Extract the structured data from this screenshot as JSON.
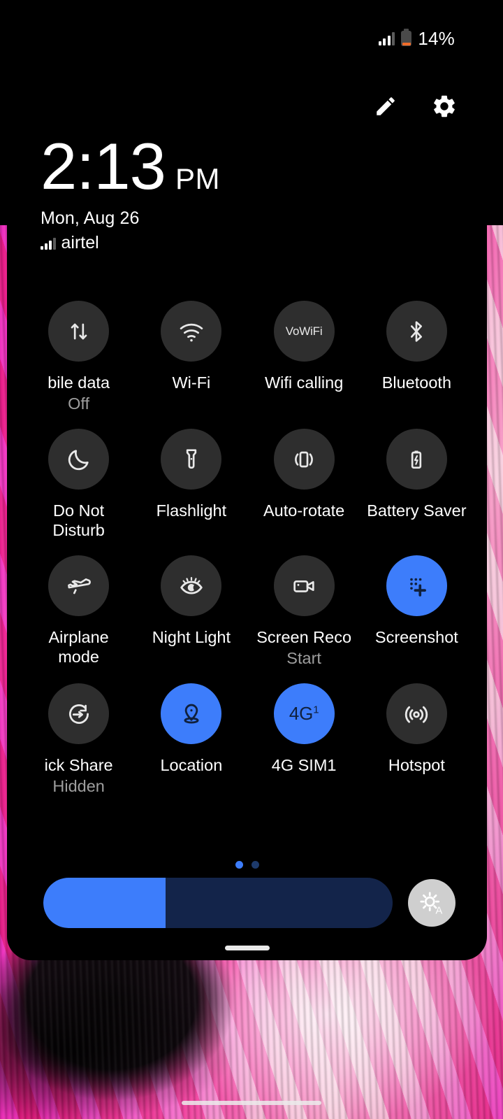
{
  "status_bar": {
    "battery_percent": "14%",
    "signal_icon": "signal-bars-icon",
    "battery_icon": "battery-low-icon",
    "battery_color": "#ef6c2a"
  },
  "panel_header": {
    "edit_icon": "pencil-edit-icon",
    "settings_icon": "gear-icon"
  },
  "clock": {
    "time": "2:13",
    "ampm": "PM",
    "date": "Mon, Aug 26",
    "carrier": "airtel",
    "carrier_signal_icon": "signal-bars-icon"
  },
  "tiles": [
    {
      "label": "bile data",
      "sub": "Off",
      "icon": "mobile-data-arrows-icon",
      "active": false,
      "clipped": true
    },
    {
      "label": "Wi-Fi",
      "sub": "",
      "icon": "wifi-icon",
      "active": false,
      "clipped": false
    },
    {
      "label": "Wifi calling",
      "sub": "",
      "icon": "vowifi-text-icon",
      "icon_text": "VoWiFi",
      "active": false,
      "clipped": false
    },
    {
      "label": "Bluetooth",
      "sub": "",
      "icon": "bluetooth-icon",
      "active": false,
      "clipped": false
    },
    {
      "label": "Do Not Disturb",
      "sub": "",
      "icon": "moon-icon",
      "active": false,
      "clipped": false
    },
    {
      "label": "Flashlight",
      "sub": "",
      "icon": "flashlight-icon",
      "active": false,
      "clipped": false
    },
    {
      "label": "Auto-rotate",
      "sub": "",
      "icon": "auto-rotate-icon",
      "active": false,
      "clipped": false
    },
    {
      "label": "Battery Saver",
      "sub": "",
      "icon": "battery-bolt-icon",
      "active": false,
      "clipped": false
    },
    {
      "label": "Airplane mode",
      "sub": "",
      "icon": "airplane-icon",
      "active": false,
      "clipped": false
    },
    {
      "label": "Night Light",
      "sub": "",
      "icon": "night-light-eye-icon",
      "active": false,
      "clipped": false
    },
    {
      "label": "Screen Reco",
      "sub": "Start",
      "icon": "video-camera-icon",
      "active": false,
      "clipped": true
    },
    {
      "label": "Screenshot",
      "sub": "",
      "icon": "screenshot-crosshair-icon",
      "active": true,
      "clipped": false
    },
    {
      "label": "ick Share",
      "sub": "Hidden",
      "icon": "quick-share-icon",
      "active": false,
      "clipped": true
    },
    {
      "label": "Location",
      "sub": "",
      "icon": "location-pin-icon",
      "active": true,
      "clipped": false
    },
    {
      "label": "4G SIM1",
      "sub": "",
      "icon": "four-g-text-icon",
      "icon_text": "4G",
      "icon_sup": "1",
      "active": true,
      "clipped": false
    },
    {
      "label": "Hotspot",
      "sub": "",
      "icon": "hotspot-icon",
      "active": false,
      "clipped": false
    }
  ],
  "pages": {
    "count": 2,
    "current": 1
  },
  "brightness": {
    "value_percent": 35,
    "auto_icon": "auto-brightness-sun-a-icon",
    "fill_color": "#3d7dfb",
    "track_color": "#13244a"
  },
  "panel": {
    "handle": "panel-drag-handle",
    "accent_color": "#3d7dfb",
    "tile_bg_color": "#2e2e2e"
  },
  "nav_bar": {
    "pill": "home-gesture-pill"
  }
}
